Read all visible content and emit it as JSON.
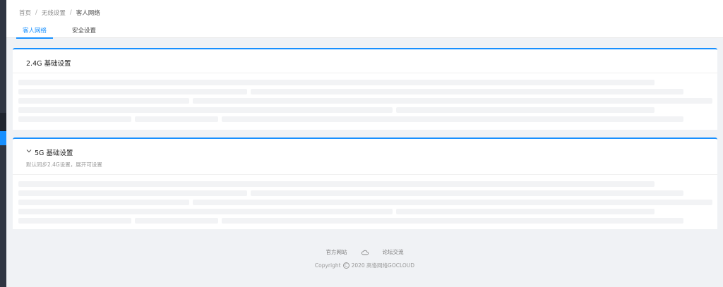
{
  "breadcrumb": [
    "首页",
    "无线设置",
    "客人网络"
  ],
  "breadcrumb_separator": "/",
  "tabs": [
    {
      "label": "客人网络",
      "active": true
    },
    {
      "label": "安全设置",
      "active": false
    }
  ],
  "cards": [
    {
      "title": "2.4G 基础设置",
      "subtitle": ""
    },
    {
      "title": "5G 基础设置",
      "subtitle": "默认同步2.4G设置，展开可设置",
      "collapsible": true
    }
  ],
  "footer": {
    "links": [
      "官方网站",
      "论坛交流"
    ],
    "cloud_icon": "cloud-icon",
    "copyright_prefix": "Copyright",
    "copyright_suffix": "2020 高恪网络GOCLOUD"
  },
  "colors": {
    "accent": "#1890ff",
    "sidebar": "#2f3542",
    "skeleton": "#f2f3f5",
    "background": "#f0f2f5"
  }
}
